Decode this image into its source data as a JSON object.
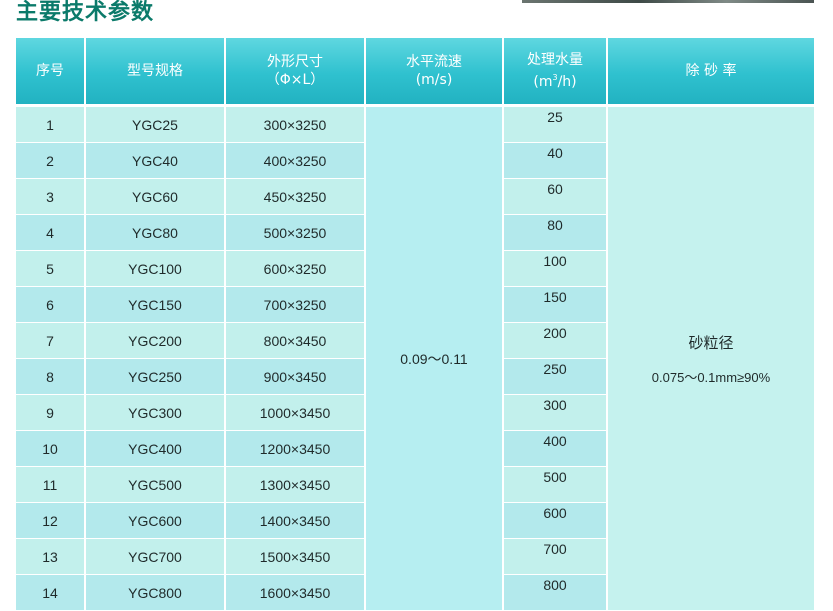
{
  "title": "主要技术参数",
  "table": {
    "headers": {
      "index": "序号",
      "model": "型号规格",
      "size_line1": "外形尺寸",
      "size_line2": "（Φ×L）",
      "flow_line1": "水平流速",
      "flow_line2": "(m/s)",
      "capacity_line1": "处理水量",
      "capacity_unit_pre": "(m",
      "capacity_unit_sup": "3",
      "capacity_unit_post": "/h)",
      "removal": "除 砂 率"
    },
    "rows": [
      {
        "index": "1",
        "model": "YGC25",
        "size": "300×3250",
        "capacity": "25"
      },
      {
        "index": "2",
        "model": "YGC40",
        "size": "400×3250",
        "capacity": "40"
      },
      {
        "index": "3",
        "model": "YGC60",
        "size": "450×3250",
        "capacity": "60"
      },
      {
        "index": "4",
        "model": "YGC80",
        "size": "500×3250",
        "capacity": "80"
      },
      {
        "index": "5",
        "model": "YGC100",
        "size": "600×3250",
        "capacity": "100"
      },
      {
        "index": "6",
        "model": "YGC150",
        "size": "700×3250",
        "capacity": "150"
      },
      {
        "index": "7",
        "model": "YGC200",
        "size": "800×3450",
        "capacity": "200"
      },
      {
        "index": "8",
        "model": "YGC250",
        "size": "900×3450",
        "capacity": "250"
      },
      {
        "index": "9",
        "model": "YGC300",
        "size": "1000×3450",
        "capacity": "300"
      },
      {
        "index": "10",
        "model": "YGC400",
        "size": "1200×3450",
        "capacity": "400"
      },
      {
        "index": "11",
        "model": "YGC500",
        "size": "1300×3450",
        "capacity": "500"
      },
      {
        "index": "12",
        "model": "YGC600",
        "size": "1400×3450",
        "capacity": "600"
      },
      {
        "index": "13",
        "model": "YGC700",
        "size": "1500×3450",
        "capacity": "700"
      },
      {
        "index": "14",
        "model": "YGC800",
        "size": "1600×3450",
        "capacity": "800"
      }
    ],
    "flow_value": "0.09～0.11",
    "removal_label": "砂粒径",
    "removal_value": "0.075～0.1mm≥90%"
  },
  "colors": {
    "title": "#0b7a6a",
    "header": "#2fc1cf",
    "row_a": "#c2f0ec",
    "row_b": "#b3e9ec"
  }
}
